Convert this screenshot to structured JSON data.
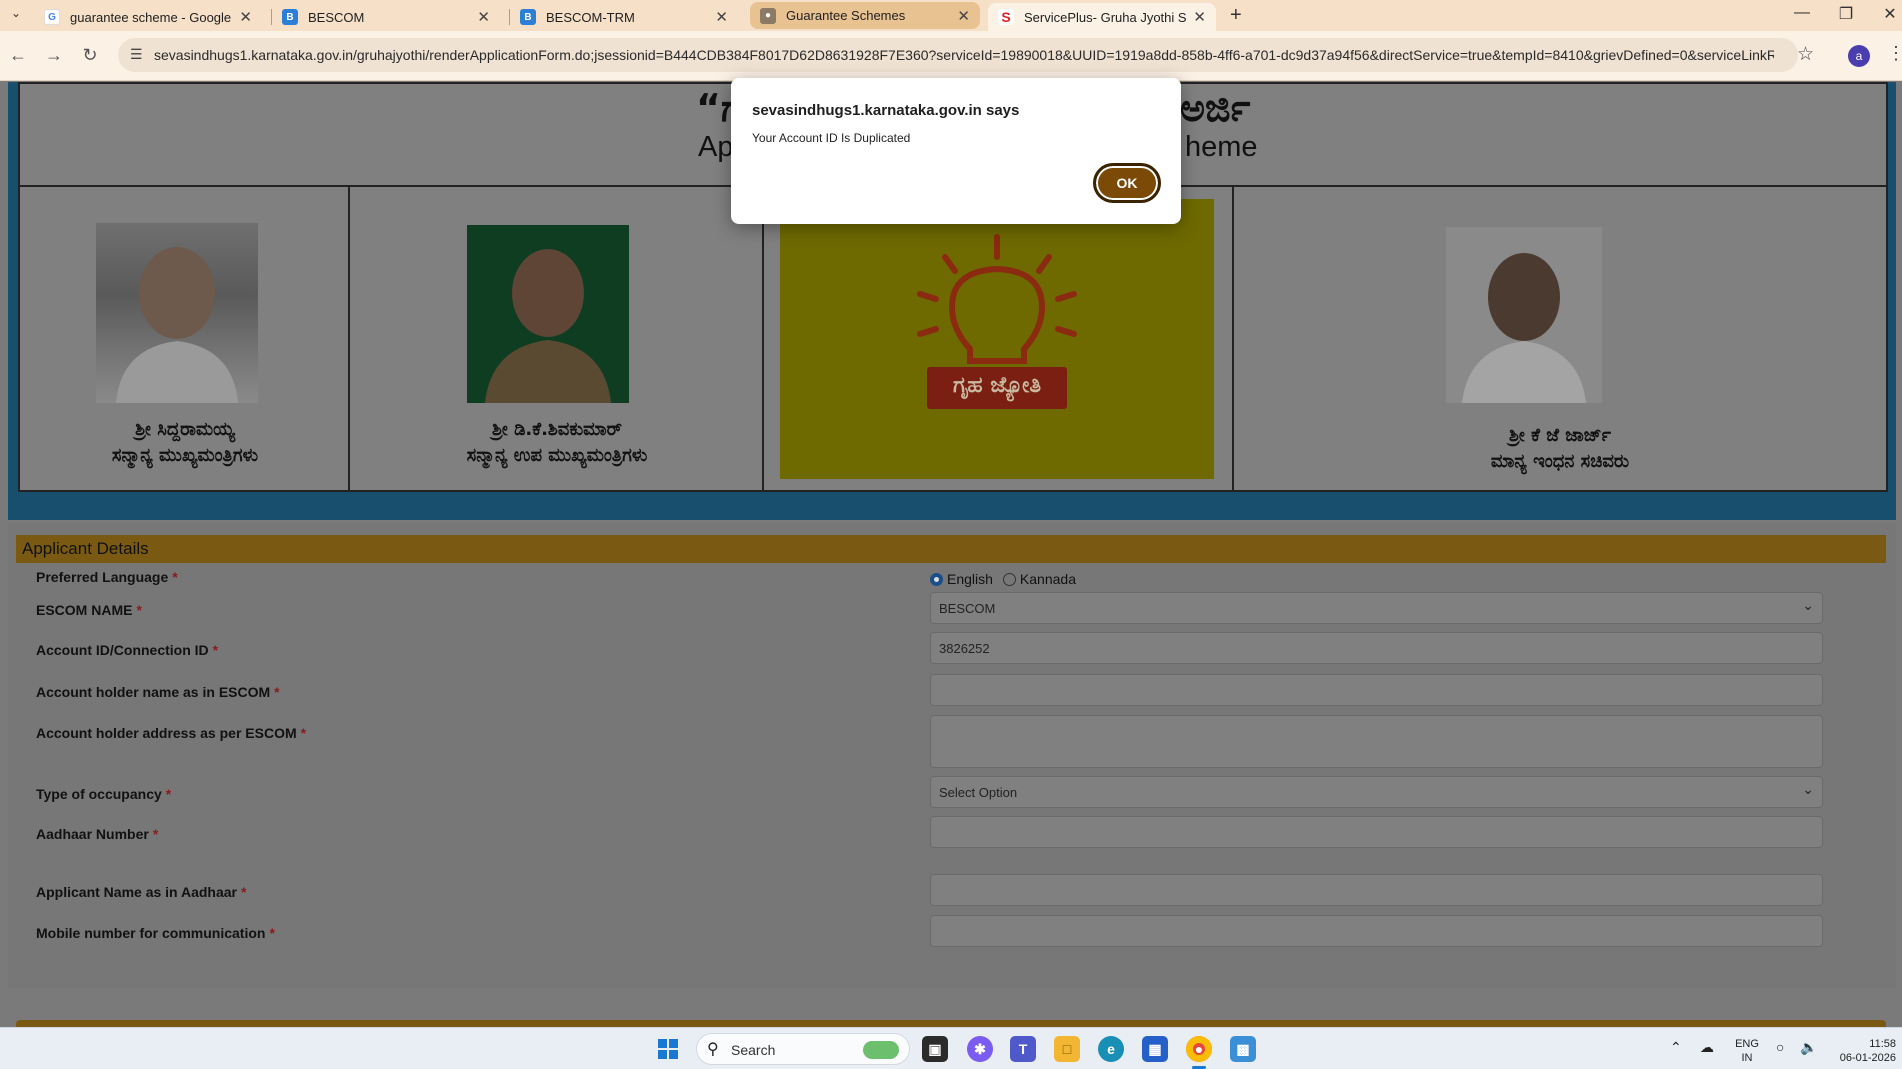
{
  "browser": {
    "tabs": [
      {
        "label": "guarantee scheme - Google Se",
        "icon": "google-icon"
      },
      {
        "label": "BESCOM",
        "icon": "bescom-icon"
      },
      {
        "label": "BESCOM-TRM",
        "icon": "bescom-icon"
      },
      {
        "label": "Guarantee Schemes",
        "icon": "globe-icon"
      },
      {
        "label": "ServicePlus- Gruha Jyothi Schen",
        "icon": "serviceplus-icon"
      }
    ],
    "url": "sevasindhugs1.karnataka.gov.in/gruhajyothi/renderApplicationForm.do;jsessionid=B444CDB384F8017D62D8631928F7E360?serviceId=19890018&UUID=1919a8dd-858b-4ff6-a701-dc9d37a94f56&directService=true&tempId=8410&grievDefined=0&serviceLinkRe...",
    "profile_initial": "a"
  },
  "banner": {
    "title_kn_left": "“ಗ",
    "title_kn_right": "ಅರ್ಜಿ",
    "title_en_left": "Ap",
    "title_en_right": "heme",
    "people": [
      {
        "name": "ಶ್ರೀ ಸಿದ್ದರಾಮಯ್ಯ",
        "role": "ಸನ್ಮಾನ್ಯ ಮುಖ್ಯಮಂತ್ರಿಗಳು"
      },
      {
        "name": "ಶ್ರೀ ಡಿ.ಕೆ.ಶಿವಕುಮಾರ್",
        "role": "ಸನ್ಮಾನ್ಯ ಉಪ ಮುಖ್ಯಮಂತ್ರಿಗಳು"
      },
      {
        "name": "ಶ್ರೀ ಕೆ ಜೆ ಜಾರ್ಜ್",
        "role": "ಮಾನ್ಯ ಇಂಧನ ಸಚಿವರು"
      }
    ],
    "logo_text": "ಗೃಹ ಜ್ಯೋತಿ"
  },
  "form": {
    "section_title": "Applicant Details",
    "preferred_language": {
      "label": "Preferred Language",
      "options": [
        "English",
        "Kannada"
      ],
      "selected": "English"
    },
    "escom_name": {
      "label": "ESCOM NAME",
      "value": "BESCOM"
    },
    "account_id": {
      "label": "Account ID/Connection ID",
      "value": "3826252"
    },
    "holder_name": {
      "label": "Account holder name as in ESCOM",
      "value": ""
    },
    "holder_address": {
      "label": "Account holder address as per ESCOM",
      "value": ""
    },
    "occupancy": {
      "label": "Type of occupancy",
      "value": "Select Option"
    },
    "aadhaar": {
      "label": "Aadhaar Number",
      "value": ""
    },
    "applicant_name": {
      "label": "Applicant Name as in Aadhaar",
      "value": ""
    },
    "mobile": {
      "label": "Mobile number for communication",
      "value": ""
    },
    "required_mark": "*"
  },
  "dialog": {
    "title": "sevasindhugs1.karnataka.gov.in says",
    "message": "Your Account ID Is Duplicated",
    "ok_label": "OK"
  },
  "taskbar": {
    "search_label": "Search",
    "lang": "ENG",
    "region": "IN",
    "time": "11:58",
    "date": "06-01-2026"
  },
  "colors": {
    "accent": "#7a4a06",
    "tabstrip": "#f6e0c8",
    "banner_frame": "#184e6e",
    "section_header": "#7a5a12"
  }
}
